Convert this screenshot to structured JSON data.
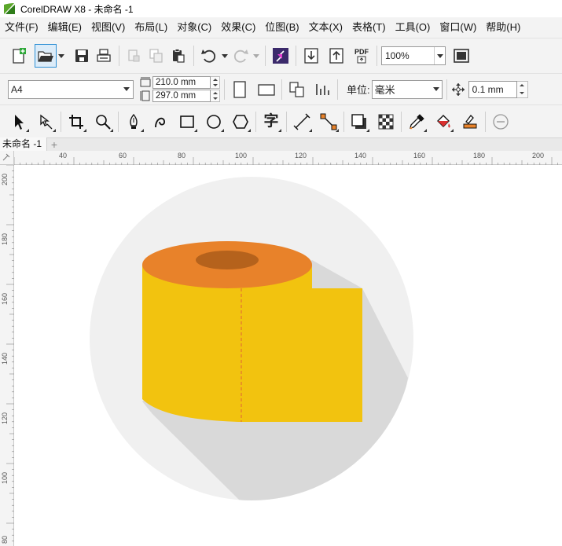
{
  "window": {
    "title": "CorelDRAW X8 - 未命名 -1"
  },
  "menu": [
    "文件(F)",
    "编辑(E)",
    "视图(V)",
    "布局(L)",
    "对象(C)",
    "效果(C)",
    "位图(B)",
    "文本(X)",
    "表格(T)",
    "工具(O)",
    "窗口(W)",
    "帮助(H)"
  ],
  "toolbar": {
    "pdf_label": "PDF",
    "zoom_value": "100%"
  },
  "property_bar": {
    "page_size": "A4",
    "width": "210.0 mm",
    "height": "297.0 mm",
    "unit_label": "单位:",
    "unit_value": "毫米",
    "nudge_value": "0.1 mm"
  },
  "toolbox": {
    "text_tool_glyph": "字"
  },
  "document_tabs": [
    {
      "label": "未命名 -1",
      "active": true
    }
  ],
  "rulers": {
    "horizontal_labels": [
      "40",
      "60",
      "80",
      "100",
      "120",
      "140",
      "160",
      "180",
      "200"
    ],
    "vertical_labels": [
      "200",
      "180",
      "160",
      "140",
      "120",
      "100",
      "80"
    ]
  },
  "colors": {
    "accent": "#2d8fd5",
    "roll_top": "#e8822a",
    "roll_hole": "#b5621c",
    "roll_body": "#f2c30f",
    "perforation": "#e8822a",
    "circle_bg": "#f0f0f0",
    "shadow": "#d9d9d9"
  }
}
